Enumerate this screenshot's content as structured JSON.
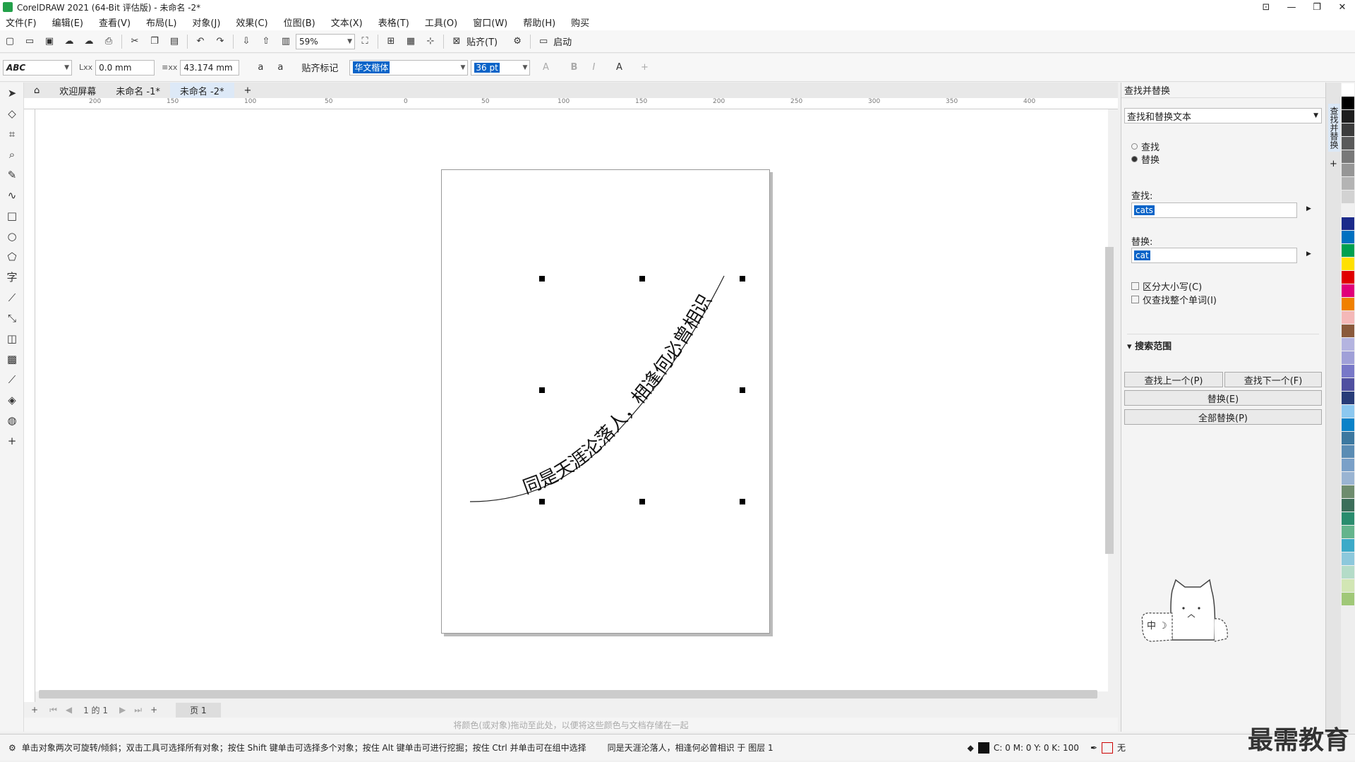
{
  "title": "CorelDRAW 2021 (64-Bit 评估版) - 未命名 -2*",
  "menu": [
    "文件(F)",
    "编辑(E)",
    "查看(V)",
    "布局(L)",
    "对象(J)",
    "效果(C)",
    "位图(B)",
    "文本(X)",
    "表格(T)",
    "工具(O)",
    "窗口(W)",
    "帮助(H)",
    "购买"
  ],
  "toolbar": {
    "zoom": "59%",
    "snap": "贴齐(T)",
    "launch": "启动"
  },
  "propbar": {
    "x": "0.0 mm",
    "y": "43.174 mm",
    "snap_mark": "贴齐标记",
    "font": "华文楷体",
    "size": "36 pt"
  },
  "tabs": [
    "欢迎屏幕",
    "未命名 -1*",
    "未命名 -2*"
  ],
  "ruler": [
    "200",
    "150",
    "100",
    "50",
    "0",
    "50",
    "100",
    "150",
    "200",
    "250",
    "300",
    "350",
    "400"
  ],
  "path_text": "同是天涯沦落人，相逢何必曾相识",
  "pagenav": {
    "count": "1 的 1",
    "page": "页 1"
  },
  "color_hint": "将颜色(或对象)拖动至此处，以便将这些颜色与文档存储在一起",
  "status": {
    "hint": "单击对象两次可旋转/倾斜；双击工具可选择所有对象；按住 Shift 键单击可选择多个对象；按住 Alt 键单击可进行挖掘；按住 Ctrl 并单击可在组中选择",
    "object": "同是天涯沦落人，相逢何必曾相识 于 图层 1",
    "cmyk": "C: 0 M: 0 Y: 0 K: 100",
    "none": "无"
  },
  "panel": {
    "title": "查找并替换",
    "mode": "查找和替换文本",
    "find_radio": "查找",
    "replace_radio": "替换",
    "find_label": "查找:",
    "find_value": "cats",
    "replace_label": "替换:",
    "replace_value": "cat",
    "case": "区分大小写(C)",
    "whole": "仅查找整个单词(I)",
    "scope": "搜索范围",
    "prev": "查找上一个(P)",
    "next": "查找下一个(F)",
    "replace_btn": "替换(E)",
    "replace_all": "全部替换(P)",
    "side_tab": "查找并替换"
  },
  "watermark": "最需教育",
  "palette": [
    "#ffffff",
    "#000000",
    "#1e1e1e",
    "#3c3c3c",
    "#5a5a5a",
    "#787878",
    "#969696",
    "#b4b4b4",
    "#d2d2d2",
    "#f0f0f0",
    "#1b2a8a",
    "#0070c0",
    "#00a050",
    "#ffe000",
    "#e00000",
    "#e0007a",
    "#f08000",
    "#f4b8b8",
    "#8a5a3c",
    "#b4b4e0",
    "#a0a0d8",
    "#7878c8",
    "#5050a0",
    "#283c78",
    "#8cc8f0",
    "#0a82c8",
    "#3c78a0",
    "#5a8cb4",
    "#7aa0c8",
    "#9ab4d2",
    "#6e8c6e",
    "#3c6e5a",
    "#2a8c6e",
    "#64b48c",
    "#3caac8",
    "#8cc8dc",
    "#b4dcc8",
    "#d2e6b4",
    "#a0c878"
  ]
}
